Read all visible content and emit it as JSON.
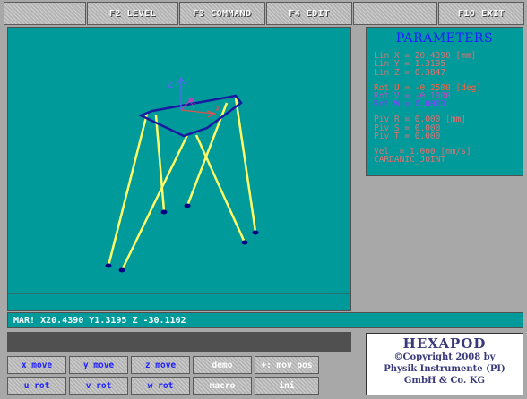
{
  "fkeys": {
    "f2": "F2 LEVEL",
    "f3": "F3 COMMAND",
    "f4": "F4 EDIT",
    "f10": "F10 EXIT"
  },
  "viewport": {
    "axis_z_label": "Z",
    "axis_y_label": "Y",
    "axis_x_label": "X",
    "colors": {
      "background": "#009a9a",
      "legs": "#ffff66",
      "platform": "#1a1aa0",
      "joints": "#000080",
      "axis_x": "#e05050",
      "axis_y": "#c040c0",
      "axis_z": "#6060ff"
    }
  },
  "parameters": {
    "title": "PARAMETERS",
    "lin_x": "Lin X = 20.4390 [mm]",
    "lin_y": "Lin Y = 1.3195",
    "lin_z": "Lin Z = 0.3847",
    "rot_u": "Rot U = -0.2500 [deg]",
    "rot_v": "Rot V = -0.1000",
    "rot_w": "Rot W = 0.0000",
    "piv_r": "Piv R = 0.000 [mm]",
    "piv_s": "Piv S = 0.000",
    "piv_t": "Piv T = 0.000",
    "vel": "Vel  = 1.000 [mm/s]",
    "joint": "CARDANIC_JOINT",
    "colors": {
      "lin": "#e07070",
      "rot_u": "#ff6040",
      "rot_v": "#c050c0",
      "rot_w": "#8040ff",
      "piv": "#e07070",
      "vel": "#e07070"
    }
  },
  "status": {
    "line": "MAR! X20.4390 Y1.3195 Z -30.1102"
  },
  "keypad": {
    "x_move": "x move",
    "y_move": "y move",
    "z_move": "z move",
    "demo": "demo",
    "mov_pos": "+: mov pos",
    "u_rot": "u rot",
    "v_rot": "v rot",
    "w_rot": "w rot",
    "macro": "macro",
    "ini": "ini"
  },
  "logo": {
    "title": "HEXAPOD",
    "line1": "©Copyright 2008 by",
    "line2": "Physik Instrumente (PI)",
    "line3": "GmbH & Co. KG"
  }
}
